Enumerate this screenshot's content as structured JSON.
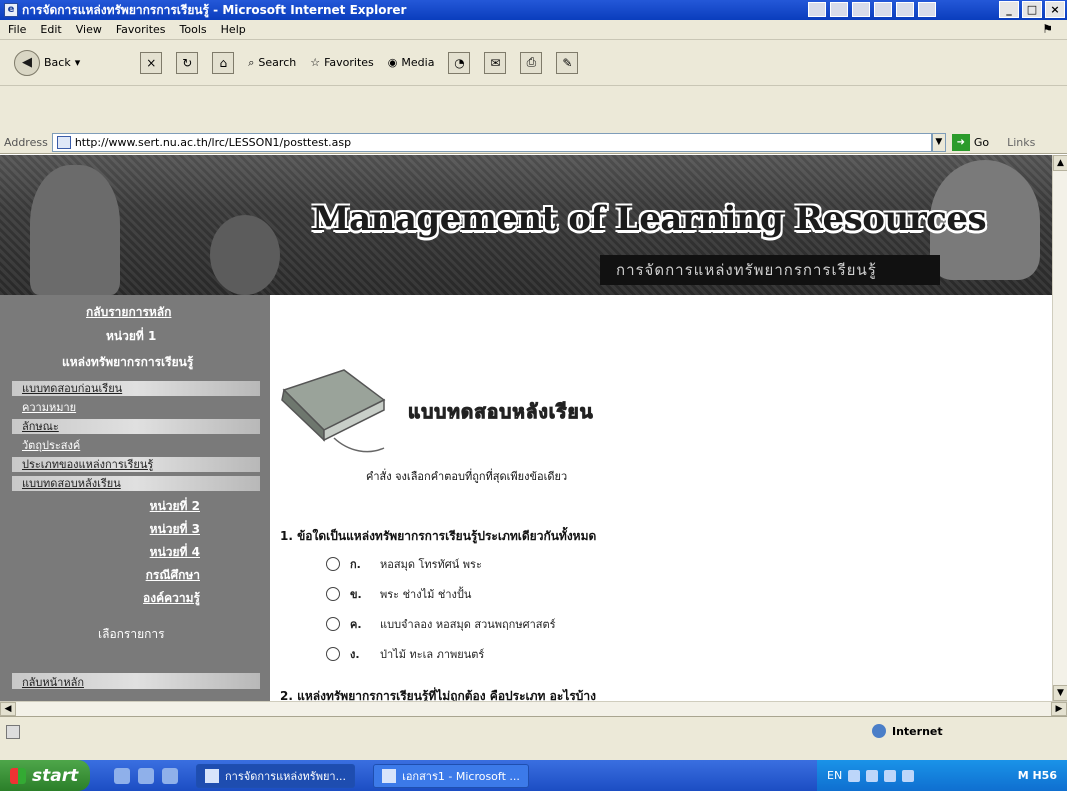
{
  "window": {
    "title": "การจัดการแหล่งทรัพยากรการเรียนรู้ - Microsoft Internet Explorer",
    "controls": [
      "_",
      "□",
      "×"
    ]
  },
  "menubar": [
    "File",
    "Edit",
    "View",
    "Favorites",
    "Tools",
    "Help"
  ],
  "toolbar": {
    "back": "Back",
    "search": "Search",
    "favorites": "Favorites",
    "media": "Media"
  },
  "address": {
    "label": "Address",
    "url": "http://www.sert.nu.ac.th/lrc/LESSON1/posttest.asp",
    "go": "Go",
    "links": "Links"
  },
  "banner": {
    "heading": "Management of Learning Resources",
    "subtitle": "การจัดการแหล่งทรัพยากรการเรียนรู้"
  },
  "sidebar": {
    "back_link": "กลับรายการหลัก",
    "unit": "หน่วยที่ 1",
    "unit_name": "แหล่งทรัพยากรการเรียนรู้",
    "lessons": [
      "แบบทดสอบก่อนเรียน",
      "ความหมาย",
      "ลักษณะ",
      "วัตถุประสงค์",
      "ประเภทของแหล่งการเรียนรู้",
      "แบบทดสอบหลังเรียน"
    ],
    "units": [
      "หน่วยที่ 2",
      "หน่วยที่ 3",
      "หน่วยที่ 4",
      "กรณีศึกษา",
      "องค์ความรู้"
    ],
    "choose_label": "เลือกรายการ",
    "main_menu": "กลับหน้าหลัก"
  },
  "test": {
    "title": "แบบทดสอบหลังเรียน",
    "instruction": "คำสั่ง จงเลือกคำตอบที่ถูกที่สุดเพียงข้อเดียว",
    "q1": "1. ข้อใดเป็นแหล่งทรัพยากรการเรียนรู้ประเภทเดียวกันทั้งหมด",
    "options": [
      {
        "letter": "ก.",
        "text": "หอสมุด โทรทัศน์ พระ"
      },
      {
        "letter": "ข.",
        "text": "พระ ช่างไม้ ช่างปั้น"
      },
      {
        "letter": "ค.",
        "text": "แบบจำลอง หอสมุด สวนพฤกษศาสตร์"
      },
      {
        "letter": "ง.",
        "text": "ป่าไม้ ทะเล ภาพยนตร์"
      }
    ],
    "q2": "2. แหล่งทรัพยากรการเรียนรู้ที่ไม่ถูกต้อง คือประเภท อะไรบ้าง"
  },
  "status": {
    "zone": "Internet"
  },
  "taskbar": {
    "start": "start",
    "task1": "การจัดการแหล่งทรัพยา...",
    "task2": "เอกสาร1 - Microsoft ...",
    "lang": "EN",
    "clock": "M H56"
  }
}
